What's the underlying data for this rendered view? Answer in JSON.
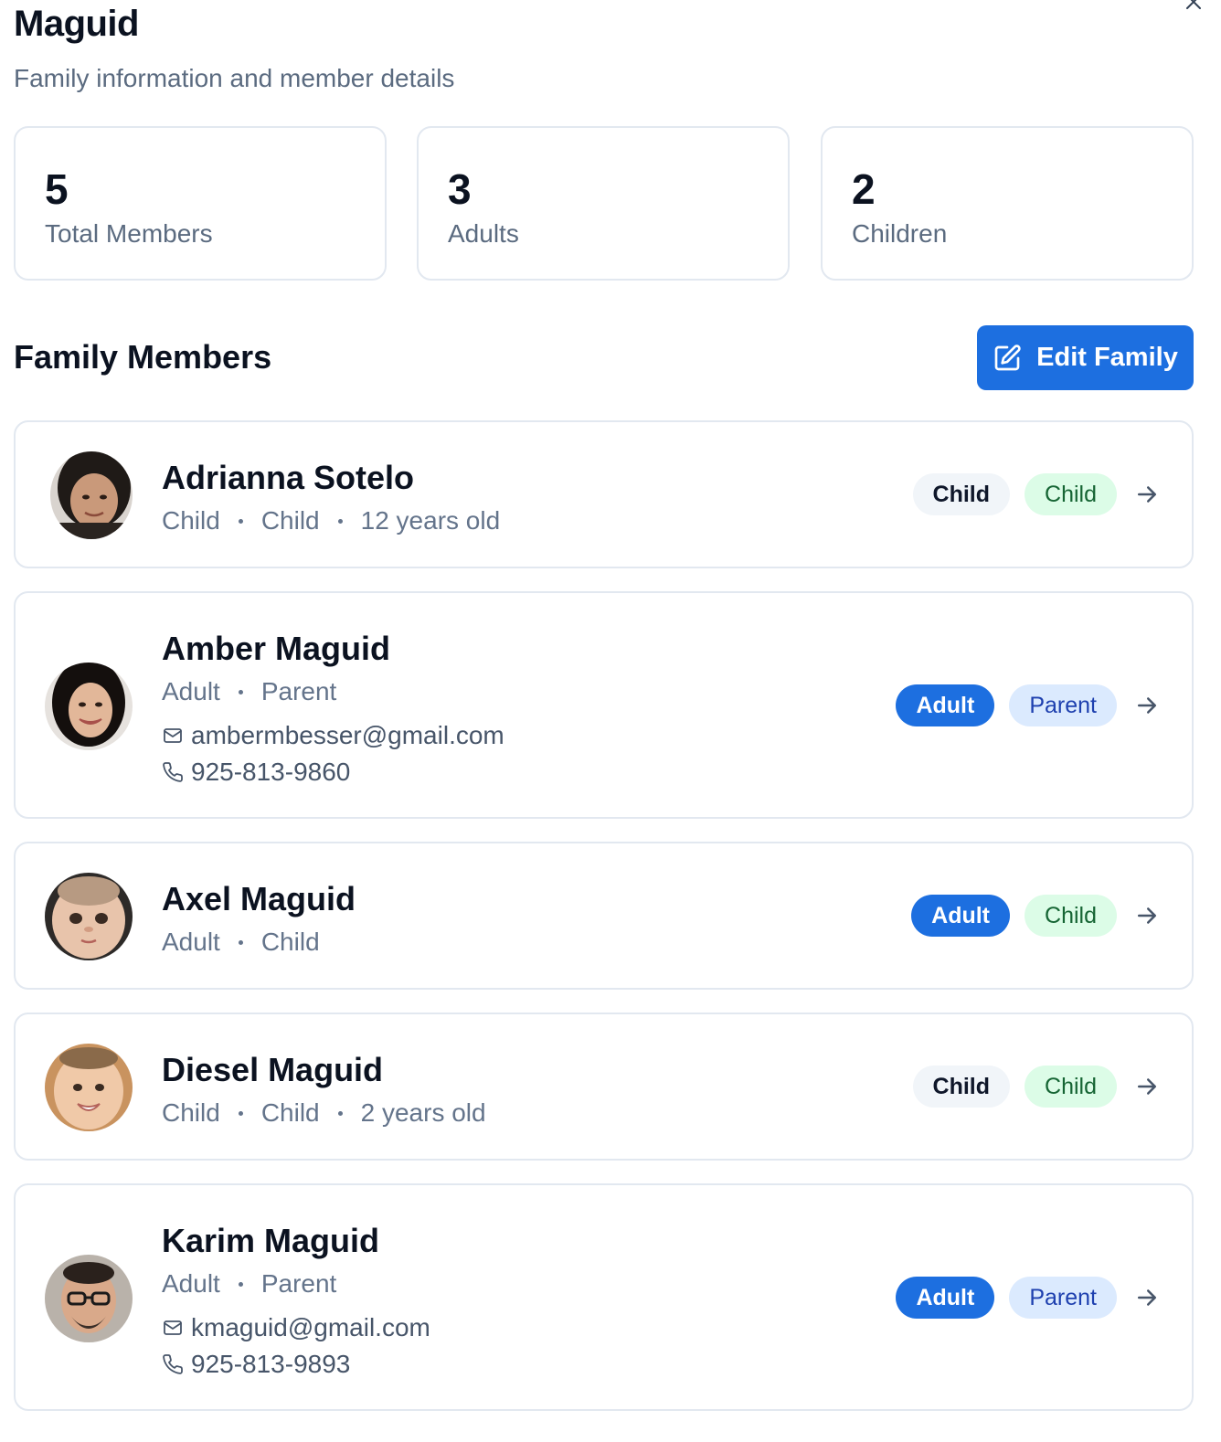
{
  "family": {
    "name": "Maguid",
    "subtitle": "Family information and member details"
  },
  "stats": [
    {
      "value": "5",
      "label": "Total Members"
    },
    {
      "value": "3",
      "label": "Adults"
    },
    {
      "value": "2",
      "label": "Children"
    }
  ],
  "section": {
    "title": "Family Members",
    "edit_label": "Edit Family"
  },
  "members": [
    {
      "name": "Adrianna Sotelo",
      "type": "Child",
      "role": "Child",
      "age": "12 years old",
      "badge_type": "Child",
      "badge_role": "Child"
    },
    {
      "name": "Amber Maguid",
      "type": "Adult",
      "role": "Parent",
      "email": "ambermbesser@gmail.com",
      "phone": "925-813-9860",
      "badge_type": "Adult",
      "badge_role": "Parent"
    },
    {
      "name": "Axel Maguid",
      "type": "Adult",
      "role": "Child",
      "badge_type": "Adult",
      "badge_role": "Child"
    },
    {
      "name": "Diesel Maguid",
      "type": "Child",
      "role": "Child",
      "age": "2 years old",
      "badge_type": "Child",
      "badge_role": "Child"
    },
    {
      "name": "Karim Maguid",
      "type": "Adult",
      "role": "Parent",
      "email": "kmaguid@gmail.com",
      "phone": "925-813-9893",
      "badge_type": "Adult",
      "badge_role": "Parent"
    }
  ],
  "icons": {
    "close": "close-icon",
    "edit": "edit-icon",
    "email": "mail-icon",
    "phone": "phone-icon",
    "arrow": "arrow-right-icon"
  },
  "colors": {
    "primary": "#1d6fe0",
    "green_badge_bg": "#dcfce7",
    "green_badge_text": "#166534",
    "lightblue_badge_bg": "#dbeafe",
    "gray_badge_bg": "#f1f5f9"
  }
}
